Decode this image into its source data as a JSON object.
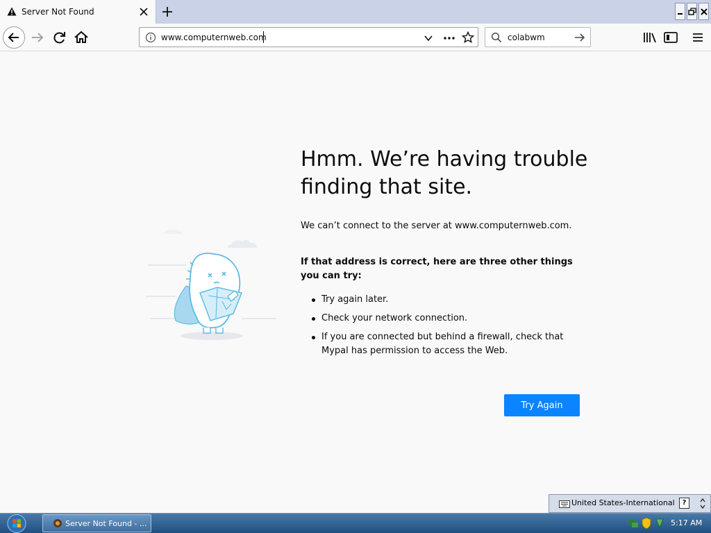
{
  "tab": {
    "title": "Server Not Found",
    "close_icon": "close-icon",
    "warning_icon": "warning-icon"
  },
  "toolbar": {
    "url": "www.computernweb.com",
    "search_value": "colabwm",
    "icons": [
      "back-icon",
      "forward-icon",
      "reload-icon",
      "home-icon",
      "info-icon",
      "chevron-down-icon",
      "more-icon",
      "star-icon",
      "search-icon",
      "go-arrow-icon",
      "library-icon",
      "sidebar-icon",
      "menu-icon"
    ]
  },
  "error": {
    "title": "Hmm. We’re having trouble finding that site.",
    "description": "We can’t connect to the server at www.computernweb.com.",
    "subheading": "If that address is correct, here are three other things you can try:",
    "suggestions": [
      "Try again later.",
      "Check your network connection.",
      "If you are connected but behind a firewall, check that Mypal has permission to access the Web."
    ],
    "try_again_label": "Try Again"
  },
  "langbar": {
    "language": "United States-International",
    "help": "?"
  },
  "taskbar": {
    "task_label": "Server Not Found - ...",
    "time": "5:17 AM"
  },
  "colors": {
    "accent": "#0a84ff",
    "page_bg": "#f9f9fa",
    "tabstrip": "#c9d2e6",
    "taskbar": "#1e4f80"
  }
}
